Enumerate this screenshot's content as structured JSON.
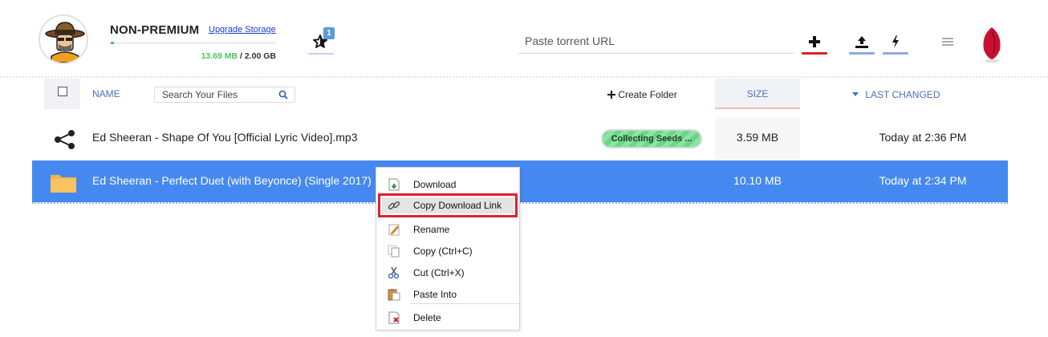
{
  "account": {
    "type": "NON-PREMIUM",
    "upgrade_label": "Upgrade Storage",
    "storage_used": "13.69 MB",
    "storage_total": "/ 2.00 GB",
    "storage_fraction": 0.0067
  },
  "favorites": {
    "badge_count": "1"
  },
  "url_input": {
    "placeholder": "Paste torrent URL",
    "value": ""
  },
  "toolbar": {
    "add_icon": "plus-icon",
    "upload_icon": "upload-icon",
    "flash_icon": "lightning-icon",
    "menu_icon": "hamburger-menu-icon"
  },
  "table_header": {
    "name": "NAME",
    "search_placeholder": "Search Your Files",
    "create_folder": "Create Folder",
    "size": "SIZE",
    "last_changed": "LAST CHANGED"
  },
  "files": [
    {
      "icon": "share-icon",
      "name": "Ed Sheeran - Shape Of You [Official Lyric Video].mp3",
      "status": "Collecting Seeds ...",
      "size": "3.59 MB",
      "changed": "Today at 2:36 PM"
    },
    {
      "icon": "folder-icon",
      "name": "Ed Sheeran - Perfect Duet (with Beyonce) (Single 2017)",
      "size": "10.10 MB",
      "changed": "Today at 2:34 PM"
    }
  ],
  "context_menu": {
    "items": [
      {
        "label": "Download",
        "icon": "download-icon"
      },
      {
        "label": "Copy Download Link",
        "icon": "link-icon"
      },
      {
        "label": "Rename",
        "icon": "rename-icon"
      },
      {
        "label": "Copy (Ctrl+C)",
        "icon": "copy-icon"
      },
      {
        "label": "Cut (Ctrl+X)",
        "icon": "cut-icon"
      },
      {
        "label": "Paste Into",
        "icon": "paste-icon"
      },
      {
        "label": "Delete",
        "icon": "delete-icon"
      }
    ]
  },
  "colors": {
    "selected_row": "#4589f0",
    "accent_blue": "#4a6fb5",
    "highlight_red": "#e02030",
    "storage_green": "#49c65c"
  }
}
